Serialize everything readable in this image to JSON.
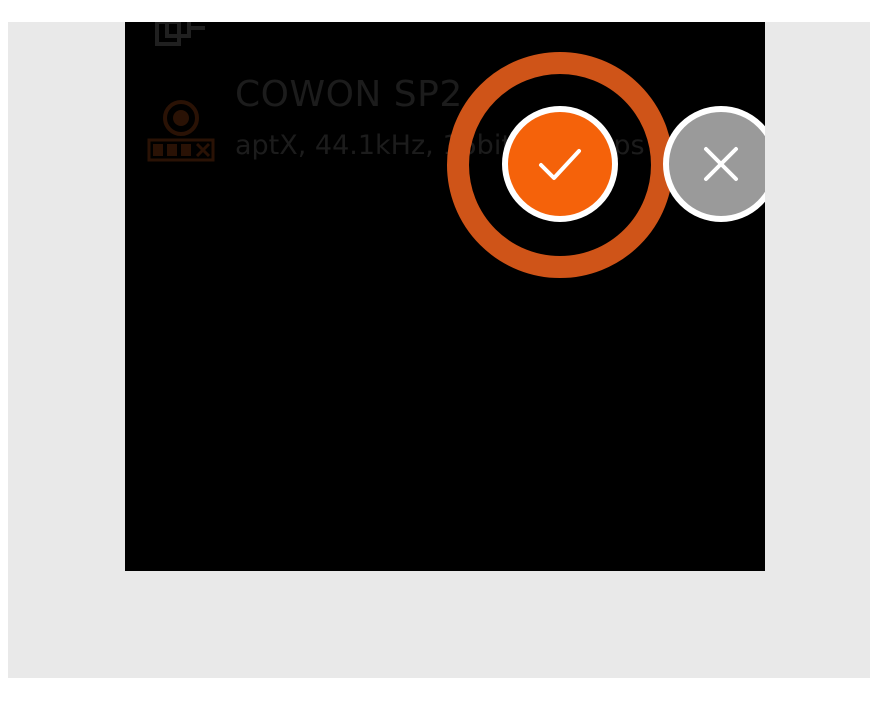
{
  "dialog": {
    "device_name": "COWON SP2",
    "device_detail": "aptX, 44.1kHz, 16bit, 352kbps",
    "confirm_icon": "checkmark-icon",
    "cancel_icon": "close-icon",
    "device_icon": "aptx-headphone-icon",
    "top_row_icon": "partial-device-icon"
  },
  "colors": {
    "screen_background": "#000000",
    "outer_frame": "#e9e9e9",
    "confirm_button": "#f5620a",
    "focus_ring": "#cf5418",
    "cancel_button": "#9a9a9a",
    "button_border": "#ffffff",
    "dimmed_text": "#1c1c1c"
  }
}
